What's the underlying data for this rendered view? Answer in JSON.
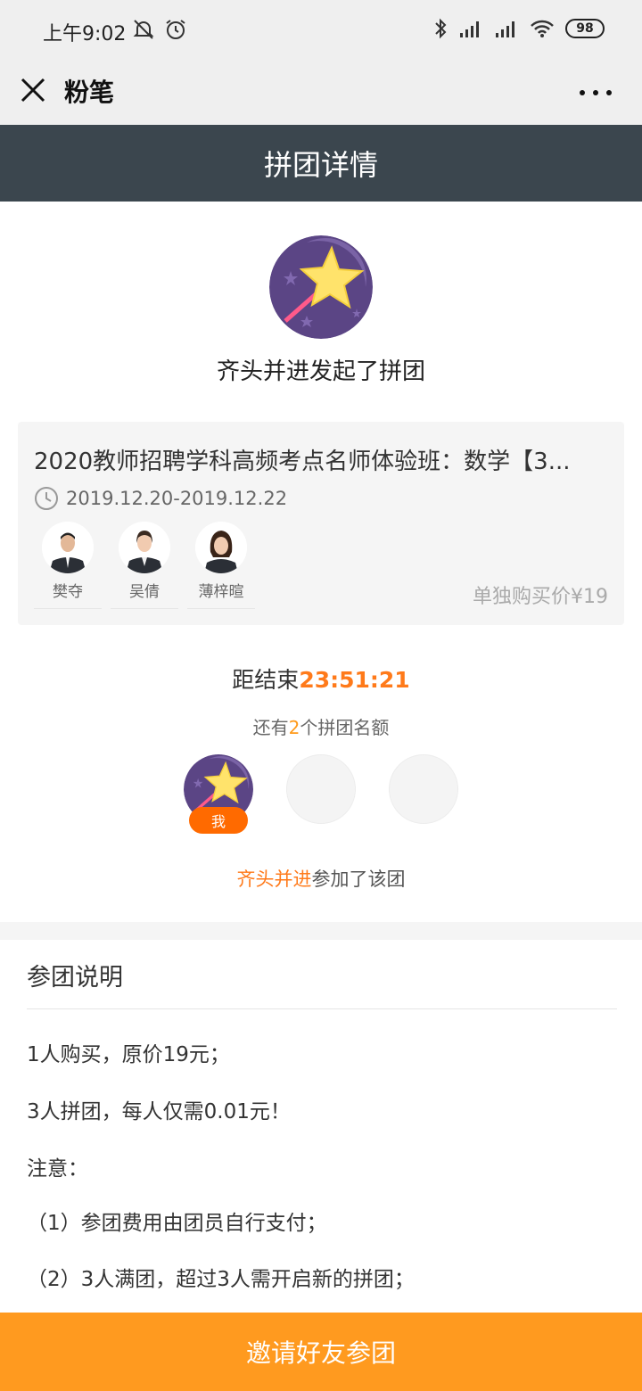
{
  "status_bar": {
    "time": "上午9:02",
    "battery": "98",
    "icons": [
      "bell-off-icon",
      "alarm-icon",
      "bluetooth-icon",
      "signal-icon",
      "signal-icon",
      "wifi-icon"
    ]
  },
  "nav": {
    "title": "粉笔",
    "close_icon": "close-icon",
    "more_icon": "more-icon"
  },
  "header": {
    "title": "拼团详情"
  },
  "initiator": {
    "avatar_icon": "magic-wand-star-icon",
    "text": "齐头并进发起了拼团"
  },
  "course": {
    "title": "2020教师招聘学科高频考点名师体验班：数学【3...",
    "clock_icon": "clock-icon",
    "date": "2019.12.20-2019.12.22",
    "teachers": [
      {
        "name": "樊夺"
      },
      {
        "name": "吴倩"
      },
      {
        "name": "薄梓暄"
      }
    ],
    "solo_price": "单独购买价¥19"
  },
  "countdown": {
    "label": "距结束",
    "time": "23:51:21"
  },
  "slots": {
    "prefix": "还有",
    "count": "2",
    "suffix": "个拼团名额"
  },
  "members": {
    "me_badge": "我"
  },
  "joined": {
    "who": "齐头并进",
    "text": "参加了该团"
  },
  "rules": {
    "title": "参团说明",
    "lines": [
      "1人购买，原价19元；",
      "3人拼团，每人仅需0.01元！",
      "注意：",
      "（1）参团费用由团员自行支付；",
      "（2）3人满团，超过3人需开启新的拼团；"
    ]
  },
  "invite_button": {
    "label": "邀请好友参团"
  },
  "colors": {
    "header_bg": "#3b464e",
    "accent_orange": "#ff7a1a",
    "button_orange": "#ff9a1f",
    "avatar_purple": "#5b4585",
    "star_yellow": "#ffe36b"
  }
}
